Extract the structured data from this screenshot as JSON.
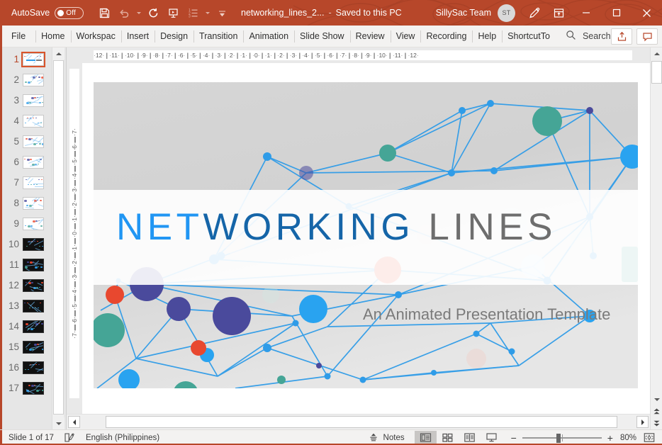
{
  "titlebar": {
    "autosave_label": "AutoSave",
    "autosave_state": "Off",
    "document_title": "networking_lines_2...",
    "separator": "-",
    "save_status": "Saved to this PC",
    "account_name": "SillySac Team",
    "avatar_initials": "ST",
    "qat": [
      {
        "name": "save-icon",
        "label": "Save"
      },
      {
        "name": "undo-icon",
        "label": "Undo"
      },
      {
        "name": "redo-icon",
        "label": "Redo"
      },
      {
        "name": "start-from-beginning-icon",
        "label": "Start From Beginning"
      },
      {
        "name": "bullet-list-icon",
        "label": "Bullets"
      },
      {
        "name": "customize-qat-icon",
        "label": "Customize Quick Access Toolbar"
      }
    ],
    "pen_icon": "pen-icon",
    "ribbon_display_icon": "ribbon-display-options-icon",
    "minimize_icon": "minimize-icon",
    "maximize_icon": "maximize-icon",
    "close_icon": "close-icon"
  },
  "ribbon": {
    "tabs": [
      {
        "label": "File"
      },
      {
        "label": "Home"
      },
      {
        "label": "Workspac"
      },
      {
        "label": "Insert"
      },
      {
        "label": "Design"
      },
      {
        "label": "Transition"
      },
      {
        "label": "Animation"
      },
      {
        "label": "Slide Show"
      },
      {
        "label": "Review"
      },
      {
        "label": "View"
      },
      {
        "label": "Recording"
      },
      {
        "label": "Help"
      },
      {
        "label": "ShortcutTo"
      }
    ],
    "search_placeholder": "Search",
    "search_icon": "search-icon",
    "share_icon": "share-icon",
    "comments_icon": "comments-icon"
  },
  "thumbnails": {
    "slides": [
      {
        "number": "1",
        "dark": false
      },
      {
        "number": "2",
        "dark": false
      },
      {
        "number": "3",
        "dark": false
      },
      {
        "number": "4",
        "dark": false
      },
      {
        "number": "5",
        "dark": false
      },
      {
        "number": "6",
        "dark": false
      },
      {
        "number": "7",
        "dark": false
      },
      {
        "number": "8",
        "dark": false
      },
      {
        "number": "9",
        "dark": false
      },
      {
        "number": "10",
        "dark": true
      },
      {
        "number": "11",
        "dark": true
      },
      {
        "number": "12",
        "dark": true
      },
      {
        "number": "13",
        "dark": true
      },
      {
        "number": "14",
        "dark": true
      },
      {
        "number": "15",
        "dark": true
      },
      {
        "number": "16",
        "dark": true
      },
      {
        "number": "17",
        "dark": true
      }
    ],
    "active_index": 0
  },
  "rulers": {
    "horizontal_ticks": [
      "12",
      "11",
      "10",
      "9",
      "8",
      "7",
      "6",
      "5",
      "4",
      "3",
      "2",
      "1",
      "0",
      "1",
      "2",
      "3",
      "4",
      "5",
      "6",
      "7",
      "8",
      "9",
      "10",
      "11",
      "12"
    ],
    "vertical_ticks": [
      "7",
      "6",
      "5",
      "4",
      "3",
      "2",
      "1",
      "0",
      "1",
      "2",
      "3",
      "4",
      "5",
      "6",
      "7"
    ]
  },
  "slide": {
    "title_parts": [
      {
        "text": "NET",
        "color": "#2196F3"
      },
      {
        "text": "WORKING",
        "color": "#1565A8"
      },
      {
        "text": " LINES",
        "color": "#6E6E6E"
      }
    ],
    "title_plain": "NETWORKING LINES",
    "subtitle": "An Animated Presentation Template",
    "palette": {
      "link": "#2196F3",
      "node_blue": "#2196F3",
      "node_teal": "#45A596",
      "node_red": "#E8482F",
      "node_indigo": "#4A4A9C",
      "background_top": "#d9d9d9",
      "band": "#FFFFFF"
    }
  },
  "statusbar": {
    "slide_counter": "Slide 1 of 17",
    "notes_icon": "notes-page-icon",
    "language": "English (Philippines)",
    "notes_label": "Notes",
    "views": [
      {
        "name": "normal-view",
        "active": true
      },
      {
        "name": "slide-sorter-view",
        "active": false
      },
      {
        "name": "reading-view",
        "active": false
      },
      {
        "name": "slide-show-view",
        "active": false
      }
    ],
    "zoom_out_label": "−",
    "zoom_in_label": "+",
    "zoom_level": "80%",
    "fit_icon": "fit-slide-to-window-icon"
  }
}
